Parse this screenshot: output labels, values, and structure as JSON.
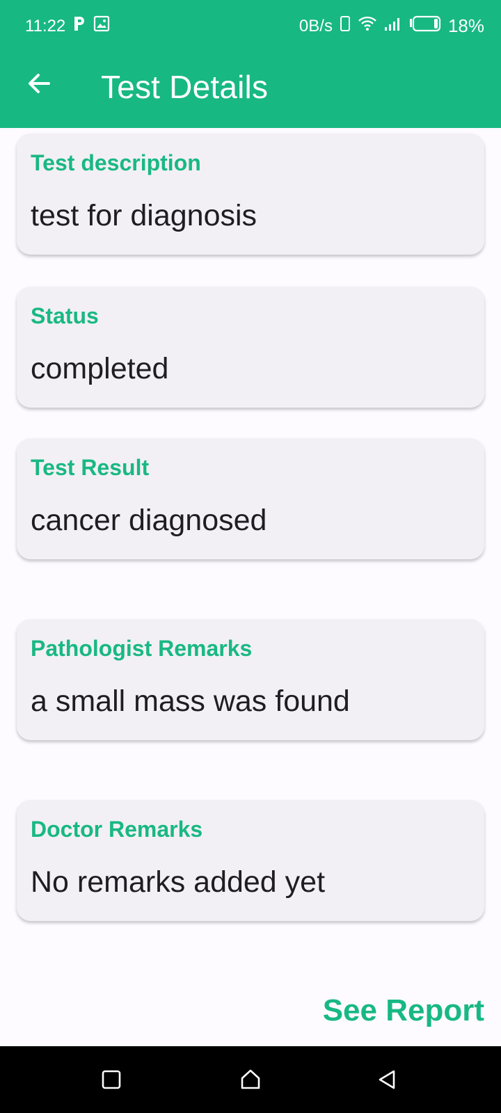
{
  "status_bar": {
    "time": "11:22",
    "net_speed": "0B/s",
    "battery": "18%",
    "icons": [
      "p-notification-icon",
      "image-notification-icon",
      "vibrate-icon",
      "wifi-icon",
      "signal-icon",
      "battery-icon"
    ]
  },
  "app_bar": {
    "title": "Test Details",
    "back_icon": "arrow-left-icon"
  },
  "cards": [
    {
      "label": "Test description",
      "value": "test for diagnosis"
    },
    {
      "label": "Status",
      "value": "completed"
    },
    {
      "label": "Test Result",
      "value": "cancer diagnosed"
    },
    {
      "label": "Pathologist Remarks",
      "value": "a small mass was found"
    },
    {
      "label": "Doctor Remarks",
      "value": "No remarks added yet"
    }
  ],
  "actions": {
    "see_report": "See Report"
  },
  "nav_bar": {
    "icons": [
      "recents-square-icon",
      "home-icon",
      "back-triangle-icon"
    ]
  },
  "colors": {
    "accent": "#18b883",
    "card_bg": "#f2f0f5",
    "page_bg": "#fdfbff",
    "text": "#1f1d22"
  }
}
